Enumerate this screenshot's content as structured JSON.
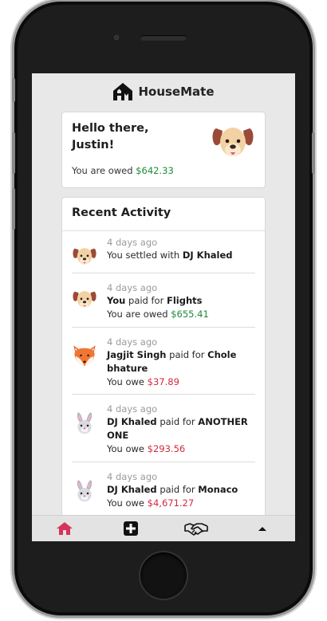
{
  "app": {
    "title": "HouseMate"
  },
  "summary": {
    "greeting_line1": "Hello there,",
    "greeting_line2": "Justin!",
    "owed_label": "You are owed",
    "owed_amount": "$642.33"
  },
  "activity": {
    "title": "Recent Activity",
    "items": [
      {
        "time": "4 days ago",
        "prefix": "You settled with",
        "name": "DJ Khaled",
        "avatar": "dog-icon"
      },
      {
        "time": "4 days ago",
        "name": "You",
        "mid": "paid for",
        "item": "Flights",
        "amount_label": "You are owed",
        "amount": "$655.41",
        "avatar": "dog-icon"
      },
      {
        "time": "4 days ago",
        "name": "Jagjit Singh",
        "mid": "paid for",
        "item": "Chole bhature",
        "amount_label": "You owe",
        "amount": "$37.89",
        "avatar": "fox-icon"
      },
      {
        "time": "4 days ago",
        "name": "DJ Khaled",
        "mid": "paid for",
        "item": "ANOTHER ONE",
        "amount_label": "You owe",
        "amount": "$293.56",
        "avatar": "rabbit-icon"
      },
      {
        "time": "4 days ago",
        "name": "DJ Khaled",
        "mid": "paid for",
        "item": "Monaco",
        "amount_label": "You owe",
        "amount": "$4,671.27",
        "avatar": "rabbit-icon"
      }
    ]
  },
  "nav": {
    "items": [
      {
        "icon": "home-icon",
        "active": true
      },
      {
        "icon": "add-icon",
        "active": false
      },
      {
        "icon": "handshake-icon",
        "active": false
      },
      {
        "icon": "caret-up-icon",
        "active": false
      }
    ]
  },
  "colors": {
    "owed_green": "#1e8a3a",
    "owe_red": "#d22a3d",
    "active_pink": "#d6335a"
  }
}
